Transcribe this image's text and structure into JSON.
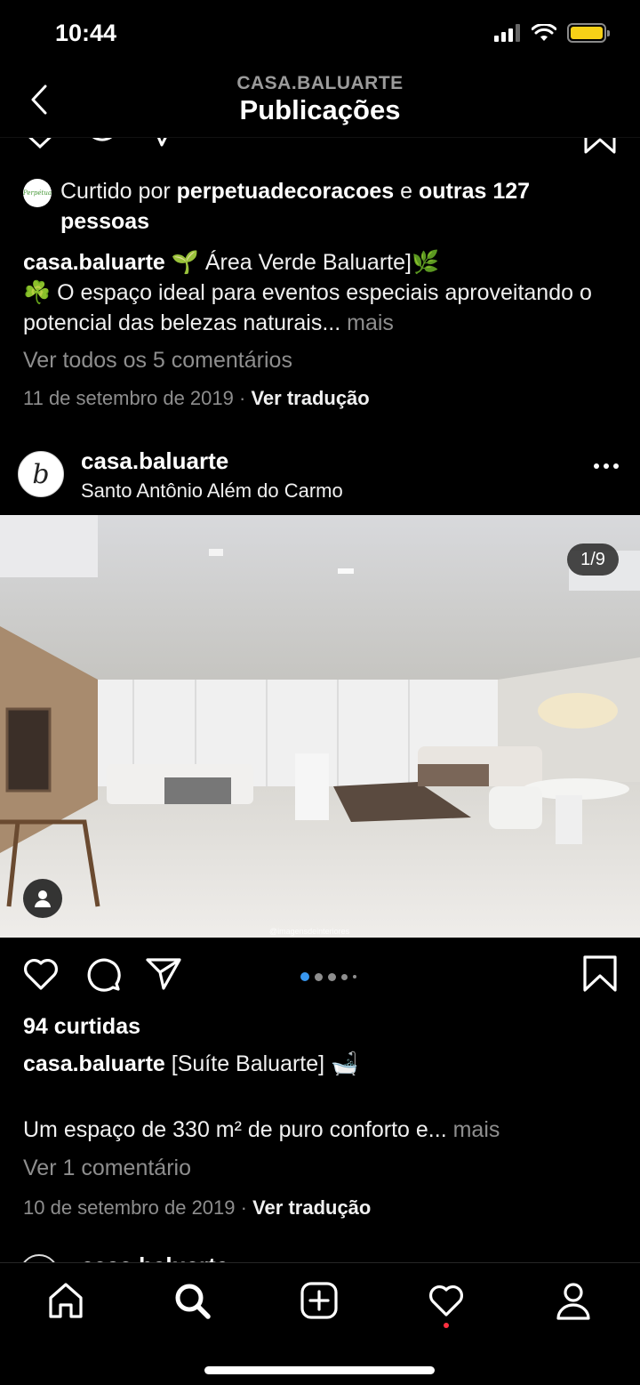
{
  "status": {
    "time": "10:44"
  },
  "header": {
    "account": "CASA.BALUARTE",
    "title": "Publicações"
  },
  "post1": {
    "liked_prefix": "Curtido por ",
    "liked_user": "perpetuadecoracoes",
    "liked_mid": " e ",
    "liked_others": "outras 127 pessoas",
    "caption_user": "casa.baluarte",
    "caption_line1": " 🌱 Área Verde Baluarte]🌿",
    "caption_line2": "☘️ O espaço ideal para eventos especiais aproveitando o potencial das belezas naturais...",
    "more": " mais",
    "comments_link": "Ver todos os 5 comentários",
    "date": "11 de setembro de 2019",
    "separator": " · ",
    "translate": "Ver tradução"
  },
  "post2": {
    "username": "casa.baluarte",
    "location": "Santo Antônio Além do Carmo",
    "image_counter": "1/9",
    "watermark": "@imagensdeinteriores",
    "likes": "94 curtidas",
    "caption_user": "casa.baluarte",
    "caption_text": " [Suíte Baluarte] 🛁",
    "caption_line2": "Um espaço de 330 m² de puro conforto e...",
    "more": " mais",
    "comments_link": "Ver 1 comentário",
    "date": "10 de setembro de 2019",
    "separator": " · ",
    "translate": "Ver tradução",
    "carousel_total_dots": 5,
    "carousel_active_index": 0
  },
  "post3": {
    "username": "casa.baluarte"
  },
  "colors": {
    "background": "#000000",
    "muted": "#8e8e8e",
    "active_dot": "#3897f0",
    "battery": "#f7d117",
    "notification": "#ff3040"
  },
  "tabs": [
    "home-icon",
    "search-icon",
    "new-post-icon",
    "activity-heart-icon",
    "profile-icon"
  ]
}
